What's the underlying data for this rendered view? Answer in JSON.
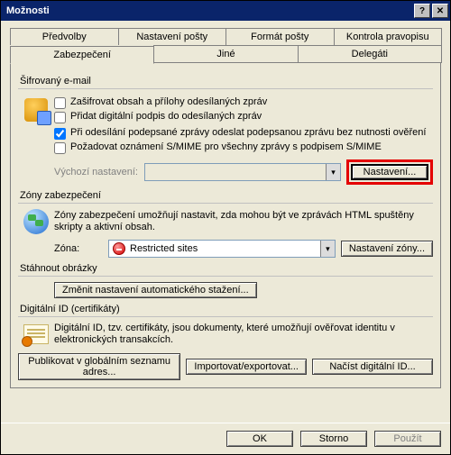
{
  "window": {
    "title": "Možnosti"
  },
  "tabs_row1": [
    {
      "label": "Předvolby"
    },
    {
      "label": "Nastavení pošty"
    },
    {
      "label": "Formát pošty"
    },
    {
      "label": "Kontrola pravopisu"
    }
  ],
  "tabs_row2": [
    {
      "label": "Zabezpečení",
      "active": true
    },
    {
      "label": "Jiné"
    },
    {
      "label": "Delegáti"
    }
  ],
  "enc": {
    "legend": "Šifrovaný e-mail",
    "c1": "Zašifrovat obsah a přílohy odesílaných zpráv",
    "c2": "Přidat digitální podpis do odesílaných zpráv",
    "c3": "Při odesílání podepsané zprávy odeslat podepsanou zprávu bez nutnosti ověření",
    "c4": "Požadovat oznámení S/MIME pro všechny zprávy s podpisem S/MIME",
    "default_label": "Výchozí nastavení:",
    "settings_btn": "Nastavení..."
  },
  "zones": {
    "legend": "Zóny zabezpečení",
    "desc": "Zóny zabezpečení umožňují nastavit, zda mohou být ve zprávách HTML spuštěny skripty a aktivní obsah.",
    "zone_label": "Zóna:",
    "zone_value": "Restricted sites",
    "zone_btn": "Nastavení zóny..."
  },
  "download": {
    "legend": "Stáhnout obrázky",
    "btn": "Změnit nastavení automatického stažení..."
  },
  "digital": {
    "legend": "Digitální ID (certifikáty)",
    "desc": "Digitální ID, tzv. certifikáty, jsou dokumenty, které umožňují ověřovat identitu v elektronických transakcích.",
    "b1": "Publikovat v globálním seznamu adres...",
    "b2": "Importovat/exportovat...",
    "b3": "Načíst digitální ID..."
  },
  "footer": {
    "ok": "OK",
    "cancel": "Storno",
    "apply": "Použít"
  }
}
